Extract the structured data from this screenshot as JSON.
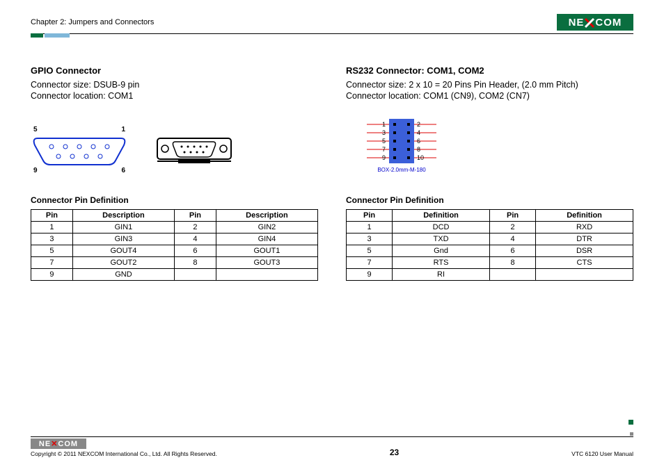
{
  "header": {
    "chapter": "Chapter 2: Jumpers and Connectors",
    "logo_text": "NE COM",
    "logo_x": "X"
  },
  "left": {
    "title": "GPIO Connector",
    "size": "Connector size: DSUB-9 pin",
    "location": "Connector location: COM1",
    "dsub_labels": {
      "tl": "5",
      "tr": "1",
      "bl": "9",
      "br": "6"
    },
    "table_title": "Connector Pin Definition",
    "table_headers": [
      "Pin",
      "Description",
      "Pin",
      "Description"
    ],
    "rows": [
      [
        "1",
        "GIN1",
        "2",
        "GIN2"
      ],
      [
        "3",
        "GIN3",
        "4",
        "GIN4"
      ],
      [
        "5",
        "GOUT4",
        "6",
        "GOUT1"
      ],
      [
        "7",
        "GOUT2",
        "8",
        "GOUT3"
      ],
      [
        "9",
        "GND",
        "",
        ""
      ]
    ]
  },
  "right": {
    "title": "RS232 Connector: COM1, COM2",
    "size": "Connector size: 2 x 10 = 20 Pins Pin Header, (2.0 mm Pitch)",
    "location": "Connector location: COM1 (CN9), COM2 (CN7)",
    "pin_labels_left": [
      "1",
      "3",
      "5",
      "7",
      "9"
    ],
    "pin_labels_right": [
      "2",
      "4",
      "6",
      "8",
      "10"
    ],
    "box_caption": "BOX-2.0mm-M-180",
    "table_title": "Connector Pin Definition",
    "table_headers": [
      "Pin",
      "Definition",
      "Pin",
      "Definition"
    ],
    "rows": [
      [
        "1",
        "DCD",
        "2",
        "RXD"
      ],
      [
        "3",
        "TXD",
        "4",
        "DTR"
      ],
      [
        "5",
        "Gnd",
        "6",
        "DSR"
      ],
      [
        "7",
        "RTS",
        "8",
        "CTS"
      ],
      [
        "9",
        "RI",
        "",
        ""
      ]
    ]
  },
  "footer": {
    "logo_text": "NE COM",
    "logo_x": "X",
    "copyright": "Copyright © 2011 NEXCOM International Co., Ltd. All Rights Reserved.",
    "page": "23",
    "doc": "VTC 6120 User Manual"
  }
}
